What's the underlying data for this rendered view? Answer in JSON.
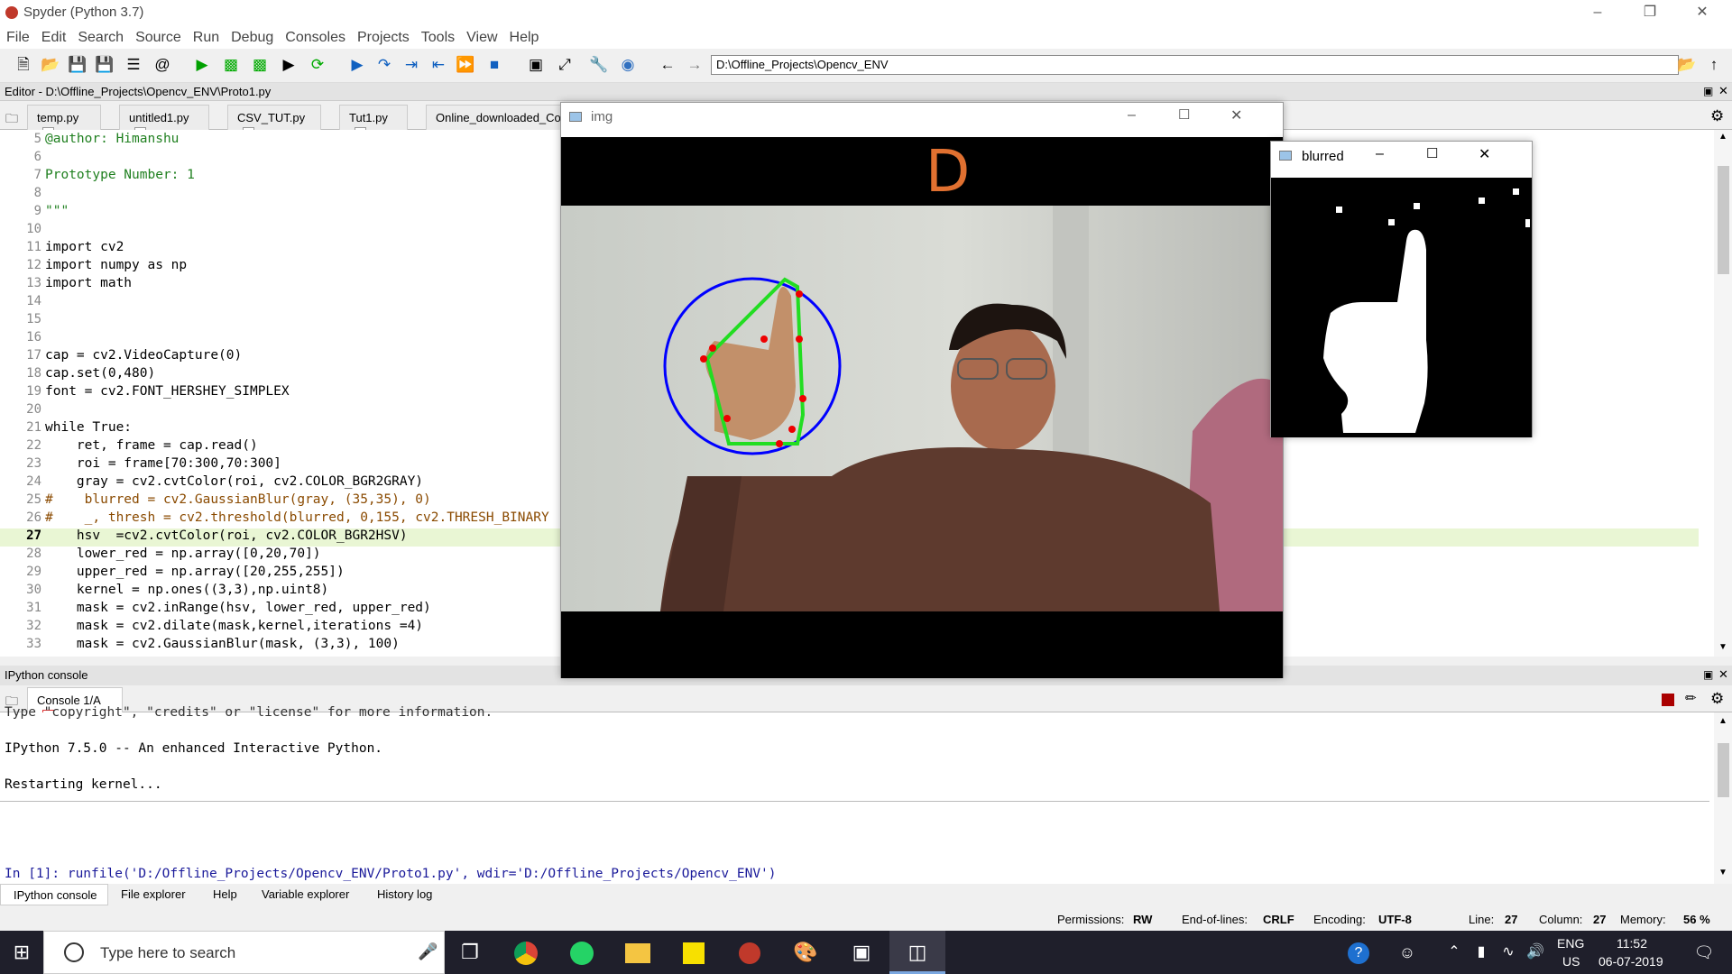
{
  "window_title": "Spyder (Python 3.7)",
  "menu": [
    "File",
    "Edit",
    "Search",
    "Source",
    "Run",
    "Debug",
    "Consoles",
    "Projects",
    "Tools",
    "View",
    "Help"
  ],
  "toolbar": {
    "path": "D:\\Offline_Projects\\Opencv_ENV"
  },
  "editor": {
    "header": "Editor - D:\\Offline_Projects\\Opencv_ENV\\Proto1.py",
    "tabs": [
      "temp.py",
      "untitled1.py",
      "CSV_TUT.py",
      "Tut1.py",
      "Online_downloaded_Co"
    ],
    "line_numbers": [
      "5",
      "6",
      "7",
      "8",
      "9",
      "10",
      "11",
      "12",
      "13",
      "14",
      "15",
      "16",
      "17",
      "18",
      "19",
      "20",
      "21",
      "22",
      "23",
      "24",
      "25",
      "26",
      "27",
      "28",
      "29",
      "30",
      "31",
      "32",
      "33"
    ],
    "lines": [
      "@author: Himanshu",
      "",
      "Prototype Number: 1",
      "",
      "\"\"\"",
      "",
      "import cv2",
      "import numpy as np",
      "import math",
      "",
      "",
      "",
      "cap = cv2.VideoCapture(0)",
      "cap.set(0,480)",
      "font = cv2.FONT_HERSHEY_SIMPLEX",
      "",
      "while True:",
      "    ret, frame = cap.read()",
      "    roi = frame[70:300,70:300]",
      "    gray = cv2.cvtColor(roi, cv2.COLOR_BGR2GRAY)",
      "#    blurred = cv2.GaussianBlur(gray, (35,35), 0)",
      "#    _, thresh = cv2.threshold(blurred, 0,155, cv2.THRESH_BINARY",
      "    hsv  =cv2.cvtColor(roi, cv2.COLOR_BGR2HSV)",
      "    lower_red = np.array([0,20,70])",
      "    upper_red = np.array([20,255,255])",
      "    kernel = np.ones((3,3),np.uint8)",
      "    mask = cv2.inRange(hsv, lower_red, upper_red)",
      "    mask = cv2.dilate(mask,kernel,iterations =4)",
      "    mask = cv2.GaussianBlur(mask, (3,3), 100)"
    ]
  },
  "console": {
    "header": "IPython console",
    "tab": "Console 1/A",
    "lines": [
      "Type \"copyright\", \"credits\" or \"license\" for more information.",
      "IPython 7.5.0 -- An enhanced Interactive Python.",
      "Restarting kernel...",
      "In [1]: runfile('D:/Offline_Projects/Opencv_ENV/Proto1.py', wdir='D:/Offline_Projects/Opencv_ENV')"
    ]
  },
  "bottom_tabs": [
    "IPython console",
    "File explorer",
    "Help",
    "Variable explorer",
    "History log"
  ],
  "status": {
    "permissions_label": "Permissions:",
    "permissions": "RW",
    "eol_label": "End-of-lines:",
    "eol": "CRLF",
    "encoding_label": "Encoding:",
    "encoding": "UTF-8",
    "line_label": "Line:",
    "line": "27",
    "column_label": "Column:",
    "column": "27",
    "memory_label": "Memory:",
    "memory": "56 %"
  },
  "img_window": {
    "title": "img",
    "letter": "D"
  },
  "blurred_window": {
    "title": "blurred"
  },
  "taskbar": {
    "search_placeholder": "Type here to search",
    "lang1": "ENG",
    "lang2": "US",
    "time": "11:52",
    "date": "06-07-2019"
  },
  "colors": {
    "accent_green": "#00a000",
    "hull": "#22dd22",
    "circle": "#0000ff",
    "defects": "#ee0000",
    "letter": "#e07030"
  }
}
